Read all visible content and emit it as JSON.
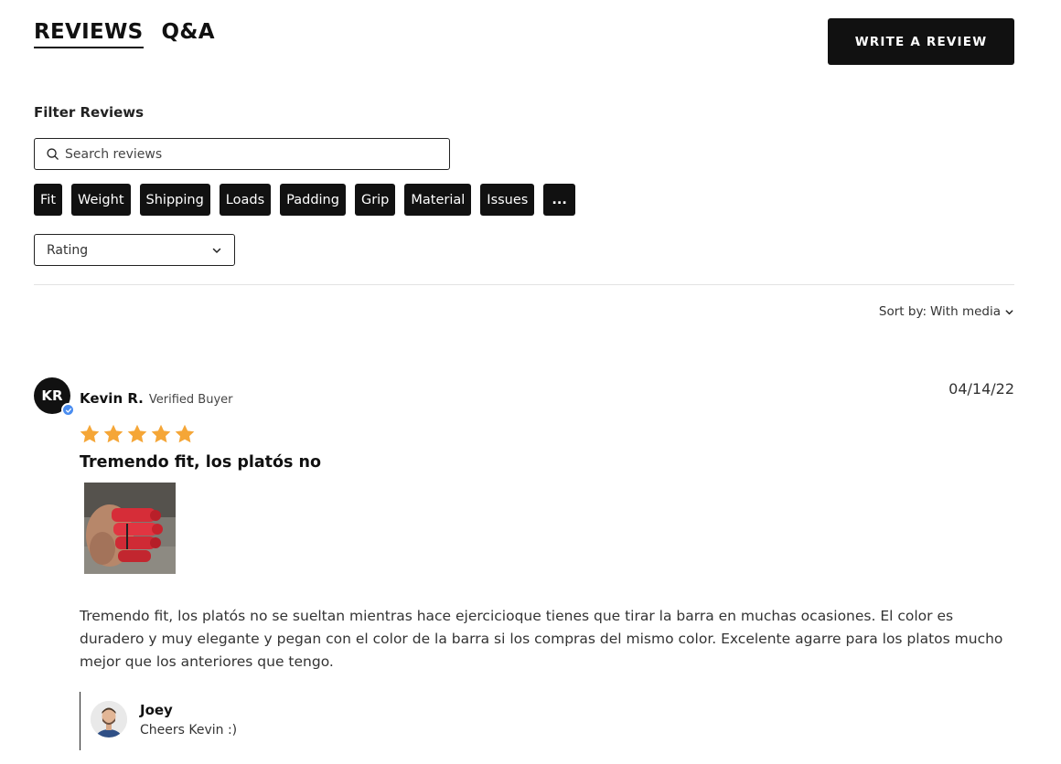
{
  "tabs": [
    {
      "label": "REVIEWS",
      "active": true
    },
    {
      "label": "Q&A",
      "active": false
    }
  ],
  "write_review_label": "WRITE A REVIEW",
  "filter": {
    "title": "Filter Reviews",
    "search_placeholder": "Search reviews",
    "chips": [
      "Fit",
      "Weight",
      "Shipping",
      "Loads",
      "Padding",
      "Grip",
      "Material",
      "Issues",
      "..."
    ],
    "rating_label": "Rating"
  },
  "sort": {
    "label": "Sort by:",
    "value": "With media"
  },
  "review": {
    "initials": "KR",
    "author": "Kevin R.",
    "badge": "Verified Buyer",
    "date": "04/14/22",
    "rating": 5,
    "rating_max": 5,
    "title": "Tremendo fit, los platós no",
    "body": "Tremendo fit, los platós no se sueltan mientras hace ejercicioque tienes que tirar la barra en muchas ocasiones. El color es duradero y muy elegante y pegan con el color de la barra si los compras del mismo color. Excelente agarre para los platos mucho mejor que los anteriores que tengo.",
    "reply": {
      "author": "Joey",
      "text": "Cheers Kevin :)"
    }
  },
  "colors": {
    "primary": "#111111",
    "star": "#f5a637",
    "verified": "#4a8df0",
    "divider": "#e3e3e3"
  },
  "icons": {
    "search": "search-icon",
    "chevron": "chevron-down-icon",
    "star": "star-icon",
    "verified": "verified-check-icon"
  }
}
